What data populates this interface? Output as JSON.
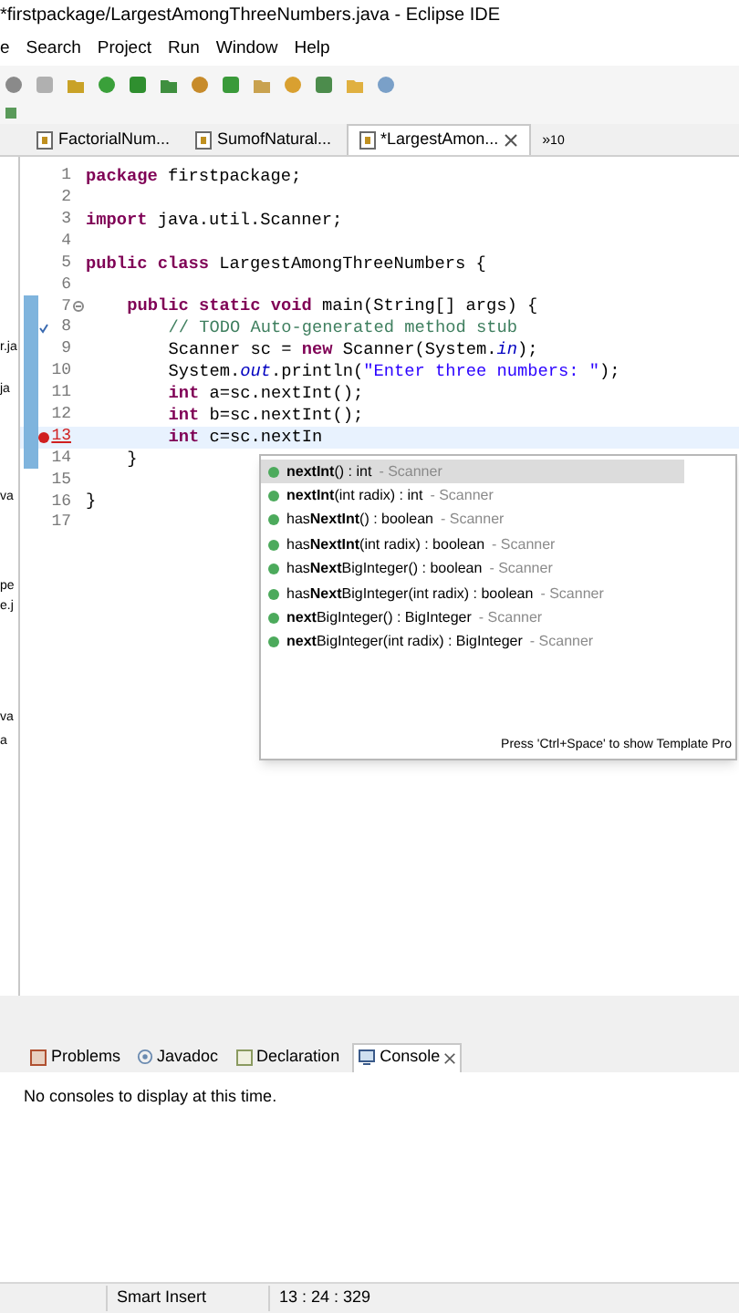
{
  "window": {
    "title": "*firstpackage/LargestAmongThreeNumbers.java - Eclipse IDE"
  },
  "menu": [
    "e",
    "Search",
    "Project",
    "Run",
    "Window",
    "Help"
  ],
  "editor_tabs": [
    {
      "label": "FactorialNum...",
      "selected": false,
      "closable": false
    },
    {
      "label": "SumofNatural...",
      "selected": false,
      "closable": false
    },
    {
      "label": "*LargestAmon...",
      "selected": true,
      "closable": true
    }
  ],
  "overflow": {
    "symbol": "»",
    "count": "10"
  },
  "left_panel": [
    "r.ja",
    "ja",
    "va",
    "pe",
    "e.j",
    "va",
    "a"
  ],
  "code_lines": [
    {
      "number": "1",
      "kind": "top",
      "segments": [
        {
          "kind": "keyword",
          "text": "package"
        },
        {
          "kind": "plain",
          "text": " firstpackage;"
        }
      ]
    },
    {
      "number": "2"
    },
    {
      "number": "3",
      "kind": "top",
      "segments": [
        {
          "kind": "keyword",
          "text": "import"
        },
        {
          "kind": "plain",
          "text": " java.util.Scanner;"
        }
      ]
    },
    {
      "number": "4"
    },
    {
      "number": "5",
      "kind": "top",
      "segments": [
        {
          "kind": "keyword",
          "text": "public class"
        },
        {
          "kind": "plain",
          "text": " LargestAmongThreeNumbers {"
        }
      ]
    },
    {
      "number": "6"
    },
    {
      "number": "7",
      "kind": "member",
      "fold": true,
      "changed": true,
      "segments": [
        {
          "kind": "keyword",
          "text": "public static void"
        },
        {
          "kind": "plain",
          "text": " main(String[] args) {"
        }
      ]
    },
    {
      "number": "8",
      "kind": "body",
      "changed": true,
      "task": true,
      "segments": [
        {
          "kind": "comment",
          "text": "// TODO Auto-generated method stub"
        }
      ]
    },
    {
      "number": "9",
      "kind": "body",
      "changed": true,
      "segments": [
        {
          "kind": "plain",
          "text": "Scanner sc = "
        },
        {
          "kind": "keyword",
          "text": "new"
        },
        {
          "kind": "plain",
          "text": " Scanner(System."
        },
        {
          "kind": "field",
          "text": "in"
        },
        {
          "kind": "plain",
          "text": ");"
        }
      ]
    },
    {
      "number": "10",
      "kind": "body",
      "changed": true,
      "segments": [
        {
          "kind": "plain",
          "text": "System."
        },
        {
          "kind": "field",
          "text": "out"
        },
        {
          "kind": "plain",
          "text": ".println("
        },
        {
          "kind": "string",
          "text": "\"Enter three numbers: \""
        },
        {
          "kind": "plain",
          "text": ");"
        }
      ]
    },
    {
      "number": "11",
      "kind": "body",
      "changed": true,
      "segments": [
        {
          "kind": "keyword",
          "text": "int"
        },
        {
          "kind": "plain",
          "text": " a=sc.nextInt();"
        }
      ]
    },
    {
      "number": "12",
      "kind": "body",
      "changed": true,
      "segments": [
        {
          "kind": "keyword",
          "text": "int"
        },
        {
          "kind": "plain",
          "text": " b=sc.nextInt();"
        }
      ]
    },
    {
      "number": "13",
      "kind": "body",
      "changed": true,
      "error": true,
      "current": true,
      "segments": [
        {
          "kind": "keyword",
          "text": "int"
        },
        {
          "kind": "plain",
          "text": " c=sc.nextIn"
        }
      ]
    },
    {
      "number": "14",
      "kind": "member",
      "changed": true,
      "segments": [
        {
          "kind": "plain",
          "text": "}"
        }
      ]
    },
    {
      "number": "15"
    },
    {
      "number": "16",
      "kind": "top",
      "segments": [
        {
          "kind": "plain",
          "text": "}"
        }
      ]
    },
    {
      "number": "17"
    }
  ],
  "proposals": [
    {
      "label": "**nextInt**() : int",
      "source": "- Scanner",
      "selected": true
    },
    {
      "label": "**nextInt**(int radix) : int",
      "source": "- Scanner",
      "selected": false
    },
    {
      "label": "has**NextInt**() : boolean",
      "source": "- Scanner",
      "selected": false
    },
    {
      "label": "has**NextInt**(int radix) : boolean",
      "source": "- Scanner",
      "selected": false
    },
    {
      "label": "has**Next**BigInteger() : boolean",
      "source": "- Scanner",
      "selected": false
    },
    {
      "label": "has**Next**BigInteger(int radix) : boolean",
      "source": "- Scanner",
      "selected": false
    },
    {
      "label": "**next**BigInteger() : BigInteger",
      "source": "- Scanner",
      "selected": false
    },
    {
      "label": "**next**BigInteger(int radix) : BigInteger",
      "source": "- Scanner",
      "selected": false
    }
  ],
  "proposal_hint": "Press 'Ctrl+Space' to show Template Pro",
  "bottom_tabs": [
    {
      "label": "Problems",
      "selected": false
    },
    {
      "label": "Javadoc",
      "selected": false
    },
    {
      "label": "Declaration",
      "selected": false
    },
    {
      "label": "Console",
      "selected": true
    }
  ],
  "console_message": "No consoles to display at this time.",
  "status_bar": {
    "insert_mode": "Smart Insert",
    "position": "13 : 24 : 329"
  }
}
